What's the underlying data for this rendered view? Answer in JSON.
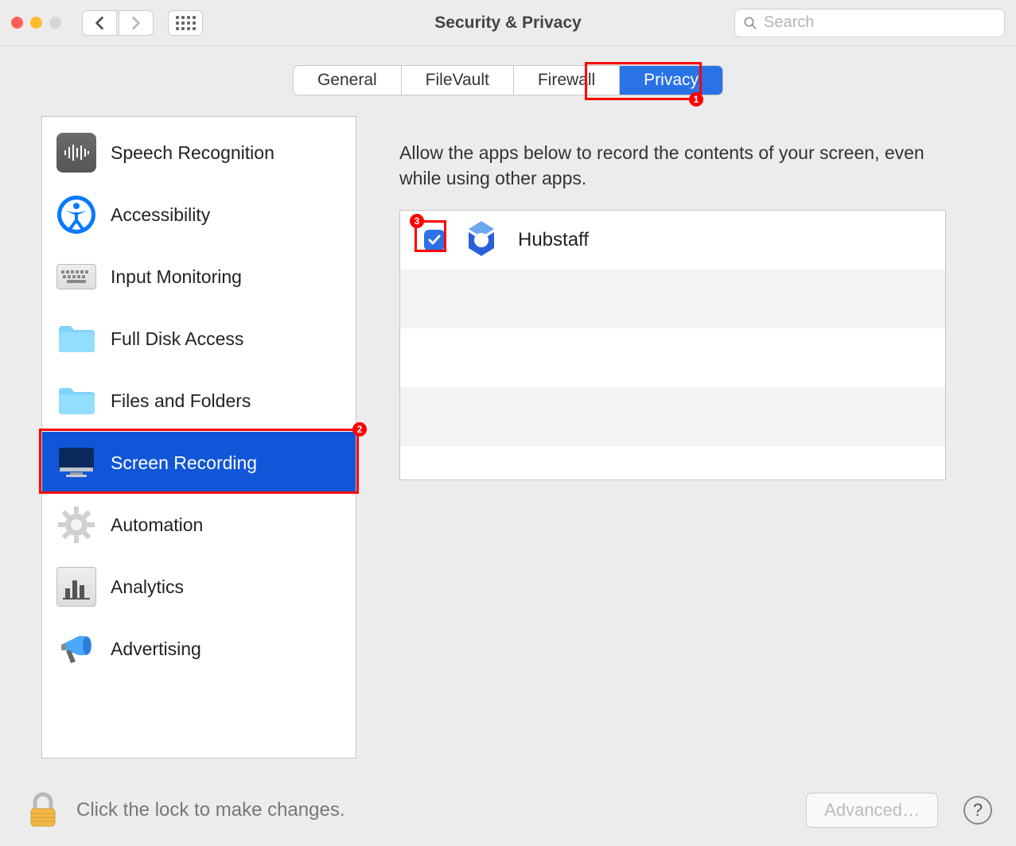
{
  "window": {
    "title": "Security & Privacy"
  },
  "search": {
    "placeholder": "Search"
  },
  "tabs": [
    {
      "label": "General",
      "active": false
    },
    {
      "label": "FileVault",
      "active": false
    },
    {
      "label": "Firewall",
      "active": false
    },
    {
      "label": "Privacy",
      "active": true
    }
  ],
  "annotations": {
    "tab_privacy_badge": "1",
    "sidebar_screenrec_badge": "2",
    "checkbox_badge": "3"
  },
  "sidebar": {
    "items": [
      {
        "label": "Speech Recognition",
        "icon": "waveform-icon"
      },
      {
        "label": "Accessibility",
        "icon": "accessibility-icon"
      },
      {
        "label": "Input Monitoring",
        "icon": "keyboard-icon"
      },
      {
        "label": "Full Disk Access",
        "icon": "folder-icon"
      },
      {
        "label": "Files and Folders",
        "icon": "folder-icon"
      },
      {
        "label": "Screen Recording",
        "icon": "monitor-icon",
        "selected": true
      },
      {
        "label": "Automation",
        "icon": "gear-icon"
      },
      {
        "label": "Analytics",
        "icon": "barchart-icon"
      },
      {
        "label": "Advertising",
        "icon": "megaphone-icon"
      }
    ]
  },
  "main": {
    "description": "Allow the apps below to record the contents of your screen, even while using other apps.",
    "apps": [
      {
        "name": "Hubstaff",
        "checked": true
      }
    ]
  },
  "footer": {
    "lock_text": "Click the lock to make changes.",
    "advanced_label": "Advanced…",
    "help_label": "?"
  }
}
